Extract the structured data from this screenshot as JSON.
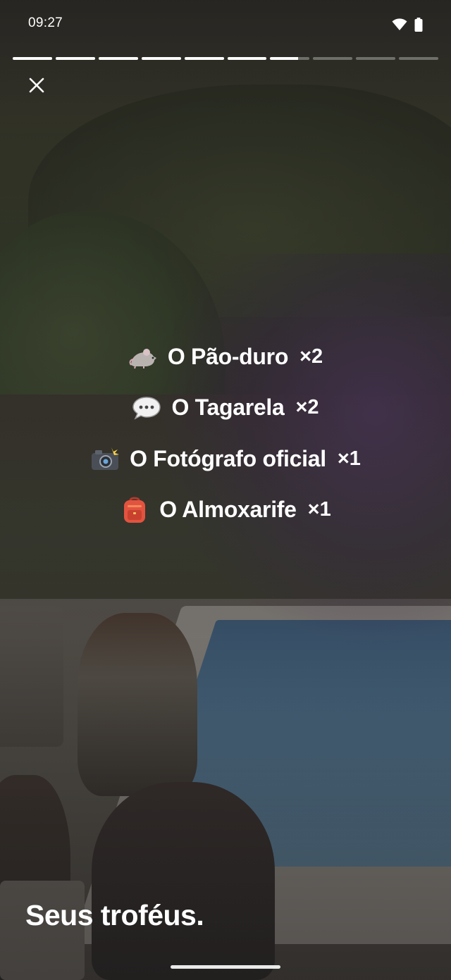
{
  "status_bar": {
    "time": "09:27",
    "icons": [
      "wifi-icon",
      "battery-icon"
    ]
  },
  "story_progress": {
    "segments_total": 10,
    "segments_completed": 6,
    "current_segment_fraction": 0.7
  },
  "close_icon": "close-icon",
  "trophies": [
    {
      "emoji": "🐀",
      "icon": "rat-icon",
      "name": "O Pão-duro",
      "count": "×2"
    },
    {
      "emoji": "💬",
      "icon": "speech-bubble-icon",
      "name": "O Tagarela",
      "count": "×2"
    },
    {
      "emoji": "📸",
      "icon": "camera-flash-icon",
      "name": "O Fotógrafo oficial",
      "count": "×1"
    },
    {
      "emoji": "🎒",
      "icon": "backpack-icon",
      "name": "O Almoxarife",
      "count": "×1"
    }
  ],
  "caption": "Seus troféus.",
  "colors": {
    "text": "#ffffff",
    "progress_done": "#ffffff",
    "progress_pending": "rgba(255,255,255,0.32)",
    "tint_purple": "#603c82"
  }
}
